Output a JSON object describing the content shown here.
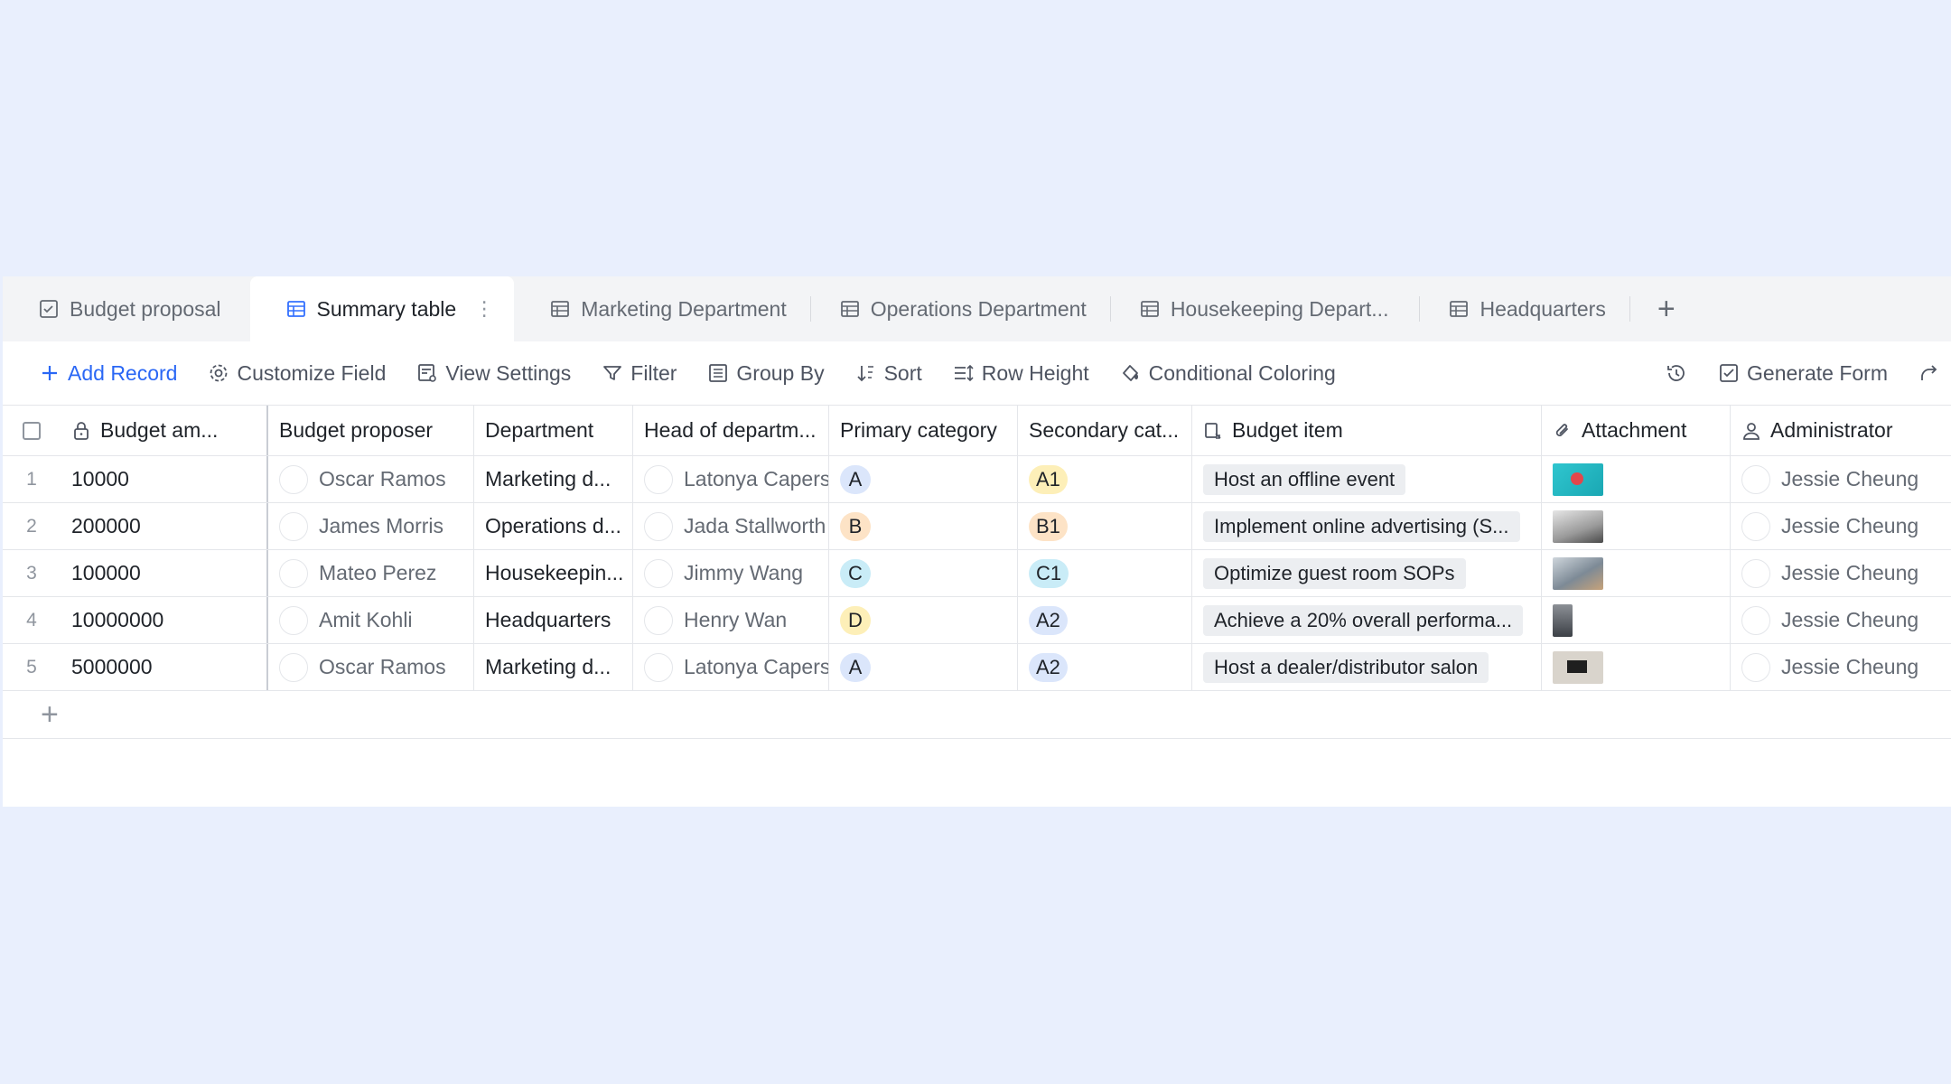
{
  "tabs": [
    {
      "label": "Budget proposal",
      "icon": "form-icon",
      "active": false
    },
    {
      "label": "Summary table",
      "icon": "table-icon",
      "active": true
    },
    {
      "label": "Marketing Department",
      "icon": "table-icon",
      "active": false
    },
    {
      "label": "Operations Department",
      "icon": "table-icon",
      "active": false
    },
    {
      "label": "Housekeeping Depart...",
      "icon": "table-icon",
      "active": false
    },
    {
      "label": "Headquarters",
      "icon": "table-icon",
      "active": false
    }
  ],
  "toolbar": {
    "add_record": "Add Record",
    "customize_field": "Customize Field",
    "view_settings": "View Settings",
    "filter": "Filter",
    "group_by": "Group By",
    "sort": "Sort",
    "row_height": "Row Height",
    "conditional_coloring": "Conditional Coloring",
    "generate_form": "Generate Form"
  },
  "columns": {
    "amount": "Budget am...",
    "proposer": "Budget proposer",
    "department": "Department",
    "head": "Head of departm...",
    "primary": "Primary category",
    "secondary": "Secondary cat...",
    "item": "Budget item",
    "attachment": "Attachment",
    "admin": "Administrator"
  },
  "rows": [
    {
      "num": "1",
      "amount": "10000",
      "proposer": "Oscar Ramos",
      "department": "Marketing d...",
      "head": "Latonya Capers",
      "primary": "A",
      "secondary": "A1",
      "item": "Host an offline event",
      "admin": "Jessie Cheung"
    },
    {
      "num": "2",
      "amount": "200000",
      "proposer": "James Morris",
      "department": "Operations d...",
      "head": "Jada Stallworth",
      "primary": "B",
      "secondary": "B1",
      "item": "Implement online advertising (S...",
      "admin": "Jessie Cheung"
    },
    {
      "num": "3",
      "amount": "100000",
      "proposer": "Mateo Perez",
      "department": "Housekeepin...",
      "head": "Jimmy Wang",
      "primary": "C",
      "secondary": "C1",
      "item": "Optimize guest room SOPs",
      "admin": "Jessie Cheung"
    },
    {
      "num": "4",
      "amount": "10000000",
      "proposer": "Amit Kohli",
      "department": "Headquarters",
      "head": "Henry Wan",
      "primary": "D",
      "secondary": "A2",
      "item": "Achieve a 20% overall performa...",
      "admin": "Jessie Cheung"
    },
    {
      "num": "5",
      "amount": "5000000",
      "proposer": "Oscar Ramos",
      "department": "Marketing d...",
      "head": "Latonya Capers",
      "primary": "A",
      "secondary": "A2",
      "item": "Host a dealer/distributor salon",
      "admin": "Jessie Cheung"
    }
  ],
  "colors": {
    "accent": "#2a67f5",
    "pill_A": "#dbe6fb",
    "pill_B": "#fde3c6",
    "pill_C": "#c9ecf7",
    "pill_D": "#fdefb8",
    "pill_A1": "#fdefb8",
    "pill_B1": "#fde3c6",
    "pill_C1": "#c9ecf7",
    "pill_A2": "#dbe6fb"
  }
}
